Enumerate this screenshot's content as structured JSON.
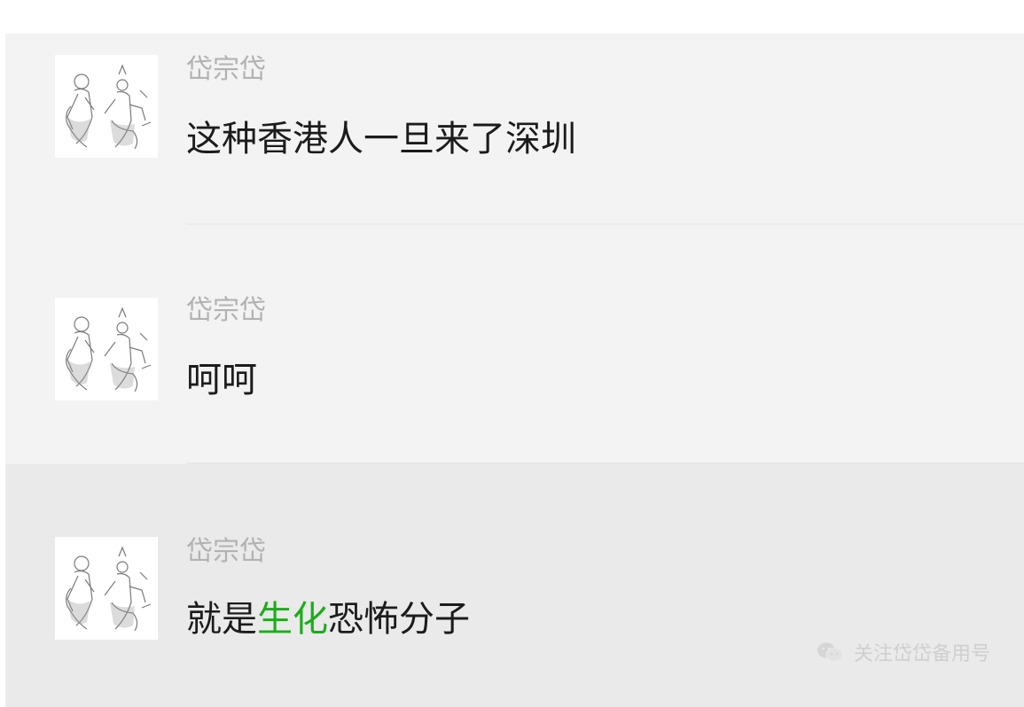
{
  "comments": [
    {
      "author": "岱宗岱",
      "avatar_icon": "sketch-figures-avatar-icon",
      "text": "这种香港人一旦来了深圳"
    },
    {
      "author": "岱宗岱",
      "avatar_icon": "sketch-figures-avatar-icon",
      "text": "呵呵"
    },
    {
      "author": "岱宗岱",
      "avatar_icon": "sketch-figures-avatar-icon",
      "text_before": "就是",
      "text_highlight": "生化",
      "text_after": "恐怖分子"
    }
  ],
  "highlight_color": "#1aad19",
  "watermark": {
    "icon": "wechat-icon",
    "text": "关注岱岱备用号"
  }
}
